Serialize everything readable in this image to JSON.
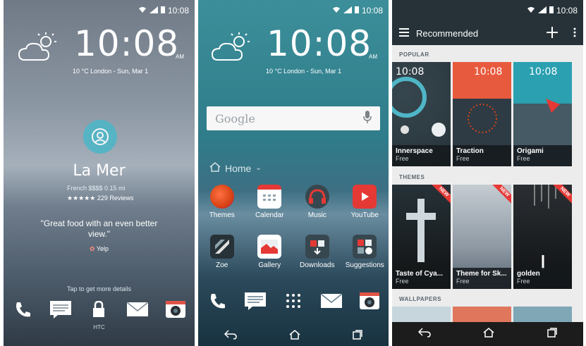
{
  "status": {
    "time": "10:08"
  },
  "lock": {
    "time": "10:08",
    "ampm": "AM",
    "date": "10 °C  London - Sun, Mar 1",
    "venue": "La Mer",
    "meta": "French  $$$$  0.15 mi",
    "reviews": "229 Reviews",
    "quote": "\"Great food with an even better view.\"",
    "source": "Yelp",
    "tap_hint": "Tap to get more details",
    "brand": "HTC"
  },
  "home": {
    "time": "10:08",
    "ampm": "AM",
    "date": "10 °C  London - Sun, Mar 1",
    "search_logo": "Google",
    "folder": "Home",
    "apps": [
      {
        "label": "Themes"
      },
      {
        "label": "Calendar"
      },
      {
        "label": "Music"
      },
      {
        "label": "YouTube"
      },
      {
        "label": "Zoe"
      },
      {
        "label": "Gallery"
      },
      {
        "label": "Downloads"
      },
      {
        "label": "Suggestions"
      }
    ]
  },
  "store": {
    "title": "Recommended",
    "popular_label": "POPULAR",
    "themes_label": "THEMES",
    "wallpapers_label": "WALLPAPERS",
    "badge": "NEW",
    "popular": [
      {
        "time": "10:08",
        "title": "Innerspace",
        "price": "Free"
      },
      {
        "time": "10:08",
        "title": "Traction",
        "price": "Free"
      },
      {
        "time": "10:08",
        "title": "Origami",
        "price": "Free"
      }
    ],
    "themes": [
      {
        "title": "Taste of Cya...",
        "price": "Free"
      },
      {
        "title": "Theme for Sk...",
        "price": "Free"
      },
      {
        "title": "golden",
        "price": "Free"
      }
    ]
  },
  "colors": {
    "accent": "#4fb6c7",
    "store_header": "#263238"
  }
}
